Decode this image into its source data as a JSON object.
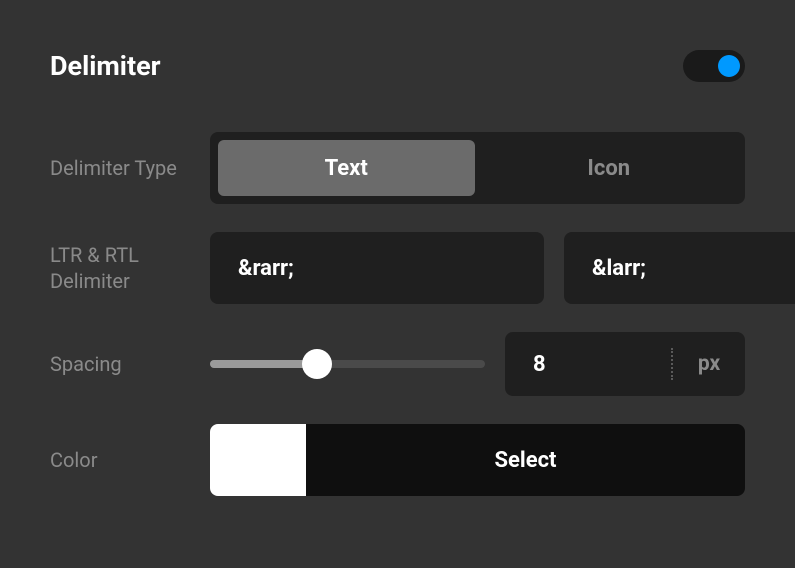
{
  "section": {
    "title": "Delimiter",
    "enabled": true
  },
  "fields": {
    "delimiterType": {
      "label": "Delimiter Type",
      "options": {
        "text": "Text",
        "icon": "Icon"
      },
      "selected": "text"
    },
    "ltrRtl": {
      "label": "LTR & RTL Delimiter",
      "ltr_value": "&rarr;",
      "rtl_value": "&larr;"
    },
    "spacing": {
      "label": "Spacing",
      "value": "8",
      "unit": "px",
      "percent": 39
    },
    "color": {
      "label": "Color",
      "swatch": "#ffffff",
      "button": "Select"
    }
  }
}
